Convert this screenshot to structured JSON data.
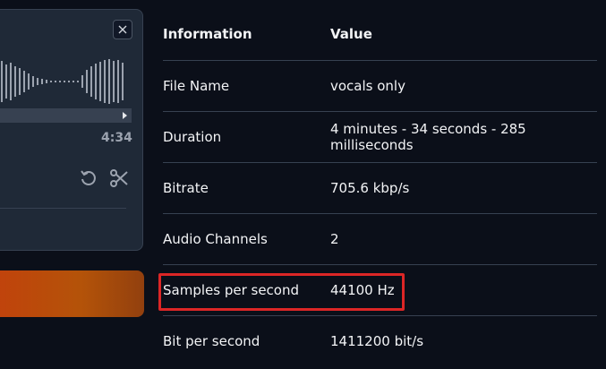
{
  "audio_player": {
    "time_display": "4:34",
    "icons": {
      "close": "close-icon",
      "undo": "undo-icon",
      "trim": "scissors-icon"
    }
  },
  "info_table": {
    "headers": {
      "key": "Information",
      "value": "Value"
    },
    "rows": [
      {
        "key": "File Name",
        "value": "vocals only"
      },
      {
        "key": "Duration",
        "value": "4 minutes - 34 seconds - 285 milliseconds"
      },
      {
        "key": "Bitrate",
        "value": "705.6 kbp/s"
      },
      {
        "key": "Audio Channels",
        "value": "2"
      },
      {
        "key": "Samples per second",
        "value": "44100 Hz"
      },
      {
        "key": "Bit per second",
        "value": "1411200 bit/s"
      }
    ]
  },
  "colors": {
    "background": "#0b0f19",
    "panel": "#1f2937",
    "accent_orange": "#c2410c",
    "highlight_red": "#dc2626"
  }
}
